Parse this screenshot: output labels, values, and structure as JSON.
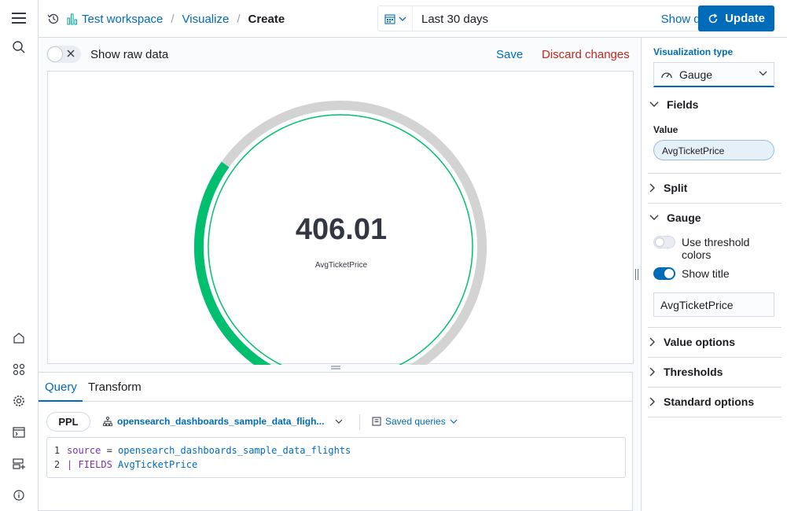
{
  "header": {
    "breadcrumbs": {
      "workspace": "Test workspace",
      "visualize": "Visualize",
      "current": "Create"
    },
    "date_range": "Last 30 days",
    "show_dates": "Show dates",
    "update": "Update"
  },
  "main": {
    "show_raw_data": "Show raw data",
    "save": "Save",
    "discard": "Discard changes",
    "gauge": {
      "value": "406.01",
      "title": "AvgTicketPrice",
      "fill_fraction": 0.33,
      "fill_color": "#00bf6f",
      "track_color": "#d3d3d3"
    },
    "query": {
      "tabs": [
        "Query",
        "Transform"
      ],
      "language": "PPL",
      "source": "opensearch_dashboards_sample_data_fligh...",
      "saved_queries": "Saved queries",
      "lines": [
        {
          "num": "1",
          "kw": "source",
          "op": " = ",
          "ident": "opensearch_dashboards_sample_data_flights"
        },
        {
          "num": "2",
          "kw": "| FIELDS",
          "op": " ",
          "ident": "AvgTicketPrice"
        }
      ]
    }
  },
  "side": {
    "viz_type_label": "Visualization type",
    "viz_type": "Gauge",
    "fields": "Fields",
    "value_label": "Value",
    "value_field": "AvgTicketPrice",
    "split": "Split",
    "gauge": "Gauge",
    "threshold_colors": "Use threshold colors",
    "show_title": "Show title",
    "title_value": "AvgTicketPrice",
    "value_options": "Value options",
    "thresholds": "Thresholds",
    "standard_options": "Standard options"
  }
}
